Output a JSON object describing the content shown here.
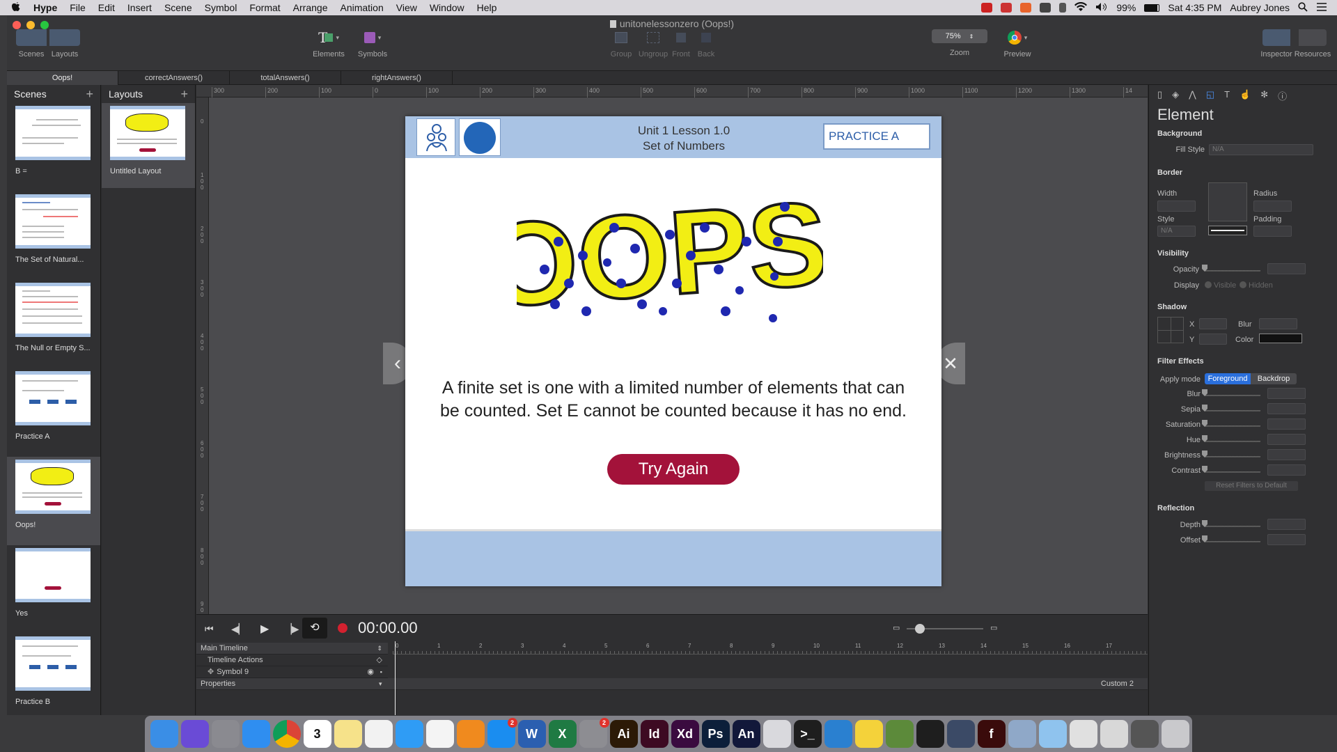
{
  "menubar": {
    "apple": "",
    "app_name": "Hype",
    "items": [
      "File",
      "Edit",
      "Insert",
      "Scene",
      "Symbol",
      "Format",
      "Arrange",
      "Animation",
      "View",
      "Window",
      "Help"
    ],
    "battery": "99%",
    "clock": "Sat 4:35 PM",
    "user": "Aubrey Jones"
  },
  "window": {
    "title": "unitonelessonzero (Oops!)",
    "toolbar": {
      "scenes": "Scenes",
      "layouts": "Layouts",
      "elements": "Elements",
      "symbols": "Symbols",
      "group": "Group",
      "ungroup": "Ungroup",
      "front": "Front",
      "back": "Back",
      "zoom_value": "75%",
      "zoom": "Zoom",
      "preview": "Preview",
      "inspector": "Inspector",
      "resources": "Resources"
    },
    "tabs": [
      "Oops!",
      "correctAnswers()",
      "totalAnswers()",
      "rightAnswers()"
    ]
  },
  "scenes_panel": {
    "title": "Scenes",
    "items": [
      {
        "label": "B ="
      },
      {
        "label": "The Set of Natural..."
      },
      {
        "label": "The Null or Empty S..."
      },
      {
        "label": "Practice A"
      },
      {
        "label": "Oops!"
      },
      {
        "label": "Yes"
      },
      {
        "label": "Practice B"
      }
    ]
  },
  "layouts_panel": {
    "title": "Layouts",
    "items": [
      {
        "label": "Untitled Layout"
      }
    ]
  },
  "rulers": {
    "h": [
      "300",
      "200",
      "100",
      "0",
      "100",
      "200",
      "300",
      "400",
      "500",
      "600",
      "700",
      "800",
      "900",
      "1000",
      "1100",
      "1200",
      "1300",
      "14"
    ],
    "v": [
      "0",
      "1\n0\n0",
      "2\n0\n0",
      "3\n0\n0",
      "4\n0\n0",
      "5\n0\n0",
      "6\n0\n0",
      "7\n0\n0",
      "8\n0\n0",
      "9\n0\n0"
    ]
  },
  "stage": {
    "header_line1": "Unit 1 Lesson 1.0",
    "header_line2": "Set of Numbers",
    "practice_label": "PRACTICE A",
    "oops_text": "OOPS!",
    "body_text_1": "A finite set is one with a limited number of elements that can",
    "body_text_2": "be counted. Set E cannot be counted because it has no end.",
    "try_again": "Try Again"
  },
  "timeline": {
    "time": "00:00.00",
    "rows": [
      "Main Timeline",
      "Timeline Actions",
      "Symbol 9",
      "Properties"
    ],
    "custom": "Custom 2",
    "ticks": [
      "0",
      "1",
      "2",
      "3",
      "4",
      "5",
      "6",
      "7",
      "8",
      "9",
      "10",
      "11",
      "12",
      "13",
      "14",
      "15",
      "16",
      "17"
    ]
  },
  "inspector": {
    "title": "Element",
    "background": "Background",
    "fill_style": "Fill Style",
    "fill_value": "N/A",
    "border": "Border",
    "width": "Width",
    "radius": "Radius",
    "style": "Style",
    "style_value": "N/A",
    "padding": "Padding",
    "visibility": "Visibility",
    "opacity": "Opacity",
    "display": "Display",
    "visible": "Visible",
    "hidden": "Hidden",
    "shadow": "Shadow",
    "x": "X",
    "y": "Y",
    "blur": "Blur",
    "color": "Color",
    "filter_effects": "Filter Effects",
    "apply_mode": "Apply mode",
    "foreground": "Foreground",
    "backdrop": "Backdrop",
    "filters": [
      "Blur",
      "Sepia",
      "Saturation",
      "Hue",
      "Brightness",
      "Contrast"
    ],
    "reset_filters": "Reset Filters to Default",
    "reflection": "Reflection",
    "depth": "Depth",
    "offset": "Offset"
  },
  "dock": {
    "badges": {
      "appstore": "2",
      "sysprefs": "2"
    },
    "calendar_day": "3",
    "apps": [
      {
        "name": "finder-icon",
        "color": "#3a8ee6",
        "glyph": ""
      },
      {
        "name": "siri-icon",
        "color": "#6a4bd6",
        "glyph": ""
      },
      {
        "name": "launchpad-icon",
        "color": "#8a8a90",
        "glyph": ""
      },
      {
        "name": "safari-icon",
        "color": "#2f8ef0",
        "glyph": ""
      },
      {
        "name": "chrome-icon",
        "color": "#e9e9e9",
        "glyph": ""
      },
      {
        "name": "calendar-icon",
        "color": "#ffffff",
        "glyph": ""
      },
      {
        "name": "notes-icon",
        "color": "#f6e28a",
        "glyph": ""
      },
      {
        "name": "reminders-icon",
        "color": "#f2f2f2",
        "glyph": ""
      },
      {
        "name": "messages-icon",
        "color": "#2f9cf5",
        "glyph": ""
      },
      {
        "name": "music-icon",
        "color": "#f4f4f4",
        "glyph": ""
      },
      {
        "name": "books-icon",
        "color": "#f08a1e",
        "glyph": ""
      },
      {
        "name": "appstore-icon",
        "color": "#1a8df0",
        "glyph": ""
      },
      {
        "name": "word-icon",
        "color": "#2b5fb0",
        "glyph": "W"
      },
      {
        "name": "excel-icon",
        "color": "#1f7a43",
        "glyph": "X"
      },
      {
        "name": "system-preferences-icon",
        "color": "#8d8d92",
        "glyph": ""
      },
      {
        "name": "illustrator-icon",
        "color": "#2c1a06",
        "glyph": "Ai"
      },
      {
        "name": "indesign-icon",
        "color": "#3d0a22",
        "glyph": "Id"
      },
      {
        "name": "xd-icon",
        "color": "#3a0b3f",
        "glyph": "Xd"
      },
      {
        "name": "photoshop-icon",
        "color": "#0c1f3a",
        "glyph": "Ps"
      },
      {
        "name": "animate-icon",
        "color": "#12183a",
        "glyph": "An"
      },
      {
        "name": "hype-icon",
        "color": "#d9d9dd",
        "glyph": ""
      },
      {
        "name": "terminal-icon",
        "color": "#1e1e1e",
        "glyph": ">_"
      },
      {
        "name": "vscode-icon",
        "color": "#2a80d0",
        "glyph": ""
      },
      {
        "name": "cyberduck-icon",
        "color": "#f4d23a",
        "glyph": ""
      },
      {
        "name": "minecraft-icon",
        "color": "#5c8a3a",
        "glyph": ""
      },
      {
        "name": "figma-icon",
        "color": "#1e1e1e",
        "glyph": ""
      },
      {
        "name": "quicktime-icon",
        "color": "#3b4a66",
        "glyph": ""
      },
      {
        "name": "flash-icon",
        "color": "#3a0b0b",
        "glyph": "f"
      },
      {
        "name": "preview-icon",
        "color": "#8fa8c8",
        "glyph": ""
      },
      {
        "name": "downloads-folder-icon",
        "color": "#8fc3ee",
        "glyph": ""
      },
      {
        "name": "documents-stack-icon",
        "color": "#e0e0e0",
        "glyph": ""
      },
      {
        "name": "files-stack-icon",
        "color": "#d8d8d8",
        "glyph": ""
      },
      {
        "name": "screen-stack-icon",
        "color": "#555",
        "glyph": ""
      },
      {
        "name": "trash-icon",
        "color": "#c9c9cc",
        "glyph": ""
      }
    ]
  }
}
